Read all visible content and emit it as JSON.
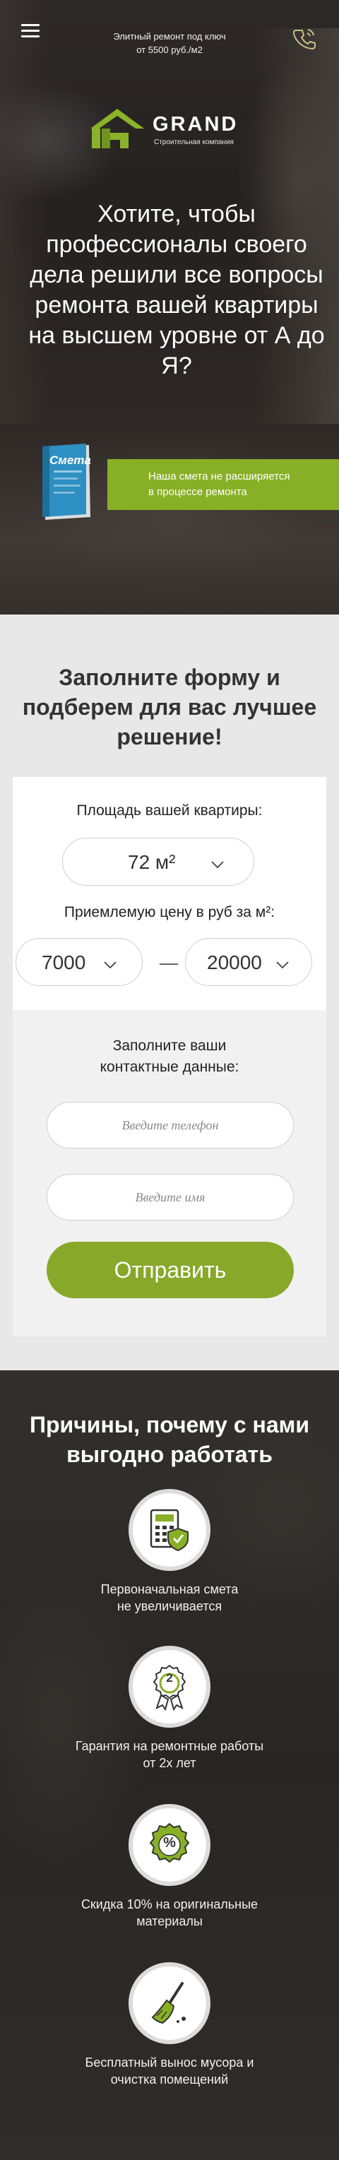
{
  "header": {
    "tagline_line1": "Элитный ремонт под ключ",
    "tagline_line2": "от 5500 руб./м2",
    "menu_icon": "hamburger-menu-icon",
    "phone_icon": "phone-icon"
  },
  "logo": {
    "word": "GRAND",
    "subtitle": "Строительная компания",
    "accent": "#8ab32a"
  },
  "hero": {
    "headline": "Хотите, чтобы профессионалы своего дела решили все вопросы ремонта вашей квартиры на высшем уровне от А до Я?",
    "book_label": "Смета",
    "smeta_line1": "Наша смета не расширяется",
    "smeta_line2": "в процессе ремонта"
  },
  "form": {
    "title": "Заполните форму и подберем для вас лучшее решение!",
    "area_label": "Площадь вашей квартиры:",
    "area_value": "72 м²",
    "price_label": "Приемлемую цену в руб за м²:",
    "price_from": "7000",
    "price_to": "20000",
    "contact_label_line1": "Заполните ваши",
    "contact_label_line2": "контактные данные:",
    "phone_placeholder": "Введите телефон",
    "name_placeholder": "Введите имя",
    "submit_label": "Отправить"
  },
  "reasons": {
    "title": "Причины, почему с нами выгодно работать",
    "items": [
      {
        "line1": "Первоначальная смета",
        "line2": "не увеличивается",
        "icon": "calculator-shield-icon"
      },
      {
        "line1": "Гарантия на ремонтные работы",
        "line2": "от 2х лет",
        "icon": "medal-icon",
        "badge": "2"
      },
      {
        "line1": "Скидка 10% на оригинальные",
        "line2": "материалы",
        "icon": "percent-badge-icon",
        "badge": "%"
      },
      {
        "line1": "Бесплатный вынос мусора и",
        "line2": "очистка помещений",
        "icon": "broom-icon"
      }
    ]
  },
  "colors": {
    "accent_green": "#88b026",
    "button_green": "#88a82a",
    "form_bg": "#e8e8e8"
  }
}
